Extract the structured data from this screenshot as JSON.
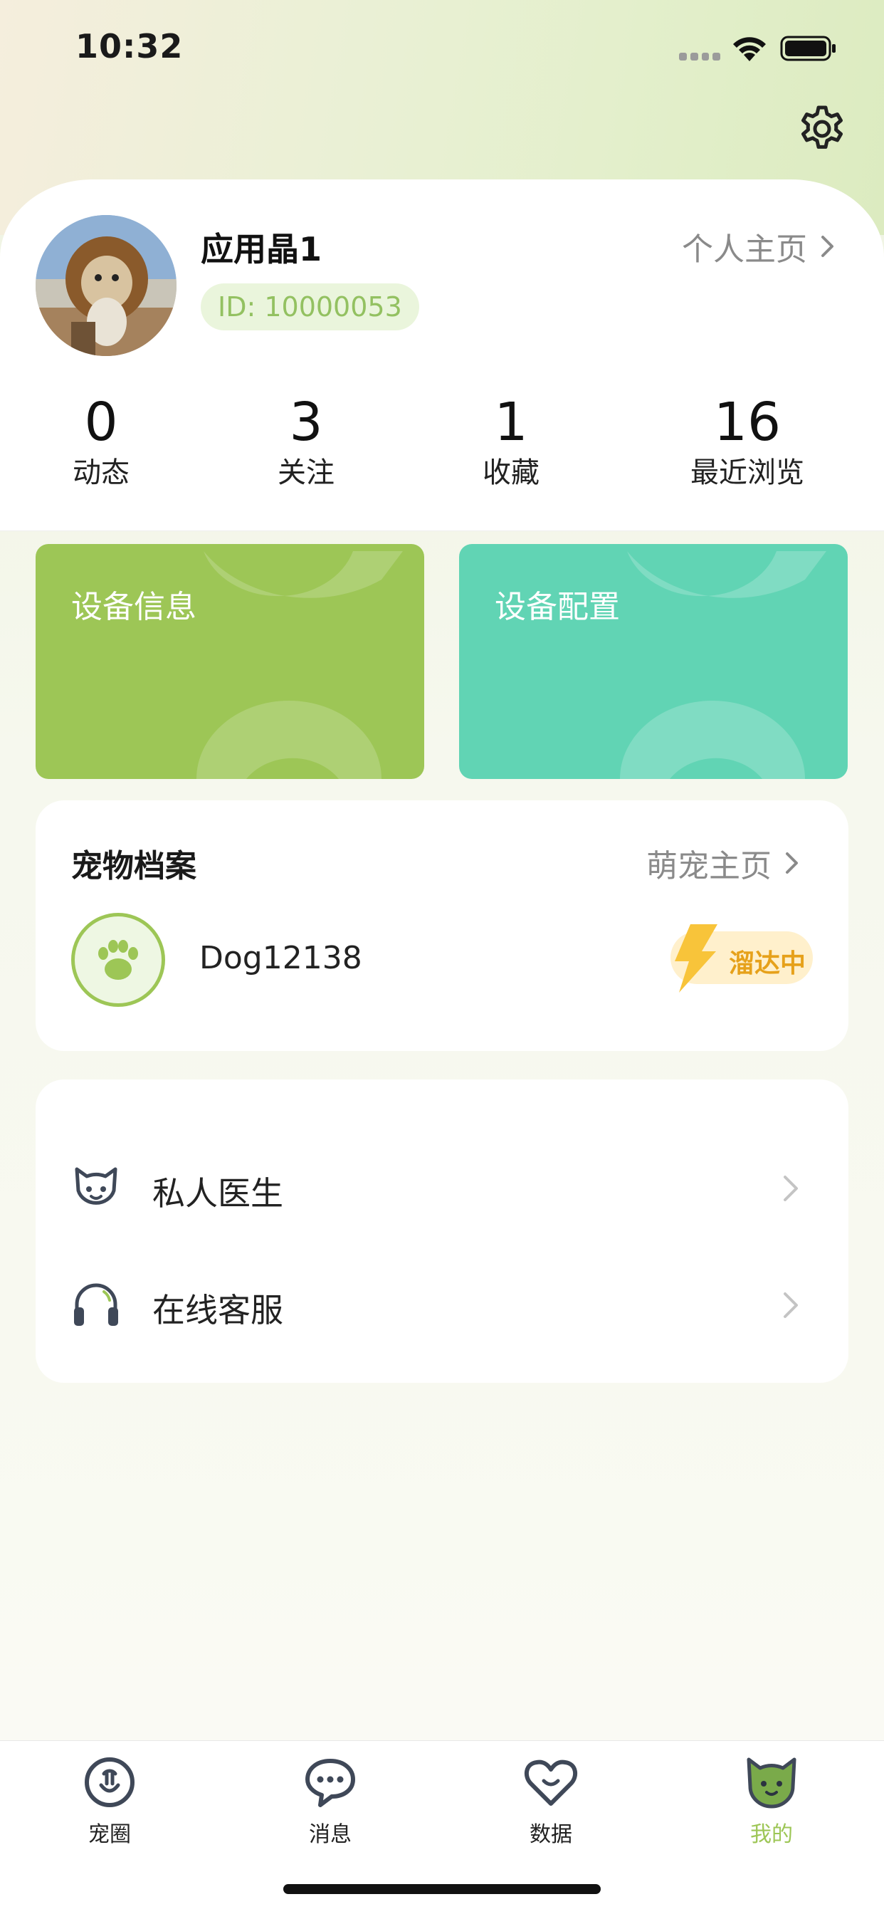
{
  "status_bar": {
    "time": "10:32"
  },
  "profile": {
    "name": "应用晶1",
    "id_text": "ID: 10000053",
    "homepage_link": "个人主页"
  },
  "stats": [
    {
      "value": "0",
      "label": "动态"
    },
    {
      "value": "3",
      "label": "关注"
    },
    {
      "value": "1",
      "label": "收藏"
    },
    {
      "value": "16",
      "label": "最近浏览"
    }
  ],
  "tiles": {
    "device_info": "设备信息",
    "device_config": "设备配置"
  },
  "pet_card": {
    "title": "宠物档案",
    "home_link": "萌宠主页",
    "pet_name": "Dog12138",
    "status": "溜达中"
  },
  "menu": [
    {
      "label": "私人医生",
      "icon": "cat-face-icon"
    },
    {
      "label": "在线客服",
      "icon": "headphones-icon"
    }
  ],
  "tab_bar": [
    {
      "label": "宠圈",
      "icon": "pet-circle-icon"
    },
    {
      "label": "消息",
      "icon": "message-bubble-icon"
    },
    {
      "label": "数据",
      "icon": "heart-icon"
    },
    {
      "label": "我的",
      "icon": "cat-face-filled-icon",
      "active": true
    }
  ],
  "colors": {
    "accent_green": "#9dc656",
    "teal": "#61d4b4",
    "status_orange": "#e6a11a",
    "id_text": "#93c161"
  }
}
